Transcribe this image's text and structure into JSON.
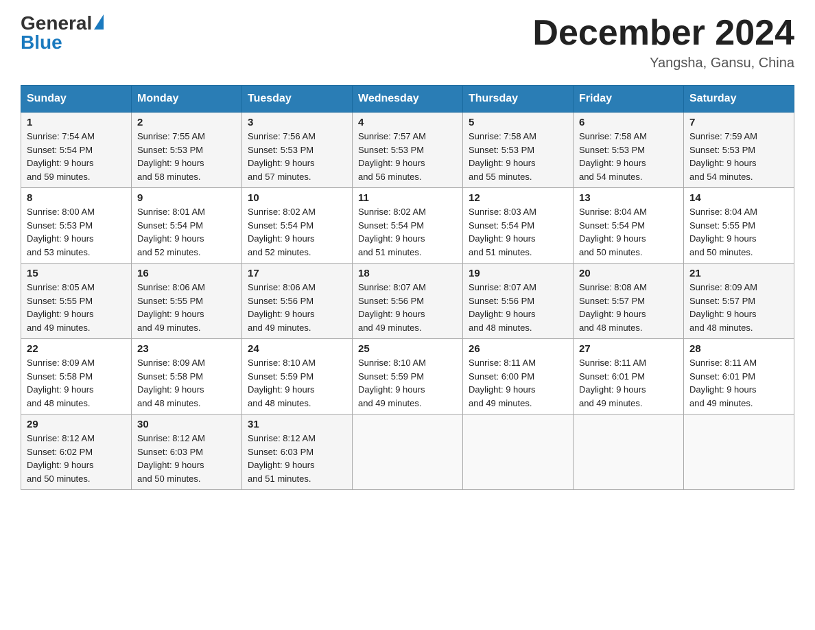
{
  "header": {
    "logo_general": "General",
    "logo_blue": "Blue",
    "month_title": "December 2024",
    "location": "Yangsha, Gansu, China"
  },
  "days_of_week": [
    "Sunday",
    "Monday",
    "Tuesday",
    "Wednesday",
    "Thursday",
    "Friday",
    "Saturday"
  ],
  "weeks": [
    [
      {
        "day": "1",
        "sunrise": "7:54 AM",
        "sunset": "5:54 PM",
        "daylight": "9 hours and 59 minutes."
      },
      {
        "day": "2",
        "sunrise": "7:55 AM",
        "sunset": "5:53 PM",
        "daylight": "9 hours and 58 minutes."
      },
      {
        "day": "3",
        "sunrise": "7:56 AM",
        "sunset": "5:53 PM",
        "daylight": "9 hours and 57 minutes."
      },
      {
        "day": "4",
        "sunrise": "7:57 AM",
        "sunset": "5:53 PM",
        "daylight": "9 hours and 56 minutes."
      },
      {
        "day": "5",
        "sunrise": "7:58 AM",
        "sunset": "5:53 PM",
        "daylight": "9 hours and 55 minutes."
      },
      {
        "day": "6",
        "sunrise": "7:58 AM",
        "sunset": "5:53 PM",
        "daylight": "9 hours and 54 minutes."
      },
      {
        "day": "7",
        "sunrise": "7:59 AM",
        "sunset": "5:53 PM",
        "daylight": "9 hours and 54 minutes."
      }
    ],
    [
      {
        "day": "8",
        "sunrise": "8:00 AM",
        "sunset": "5:53 PM",
        "daylight": "9 hours and 53 minutes."
      },
      {
        "day": "9",
        "sunrise": "8:01 AM",
        "sunset": "5:54 PM",
        "daylight": "9 hours and 52 minutes."
      },
      {
        "day": "10",
        "sunrise": "8:02 AM",
        "sunset": "5:54 PM",
        "daylight": "9 hours and 52 minutes."
      },
      {
        "day": "11",
        "sunrise": "8:02 AM",
        "sunset": "5:54 PM",
        "daylight": "9 hours and 51 minutes."
      },
      {
        "day": "12",
        "sunrise": "8:03 AM",
        "sunset": "5:54 PM",
        "daylight": "9 hours and 51 minutes."
      },
      {
        "day": "13",
        "sunrise": "8:04 AM",
        "sunset": "5:54 PM",
        "daylight": "9 hours and 50 minutes."
      },
      {
        "day": "14",
        "sunrise": "8:04 AM",
        "sunset": "5:55 PM",
        "daylight": "9 hours and 50 minutes."
      }
    ],
    [
      {
        "day": "15",
        "sunrise": "8:05 AM",
        "sunset": "5:55 PM",
        "daylight": "9 hours and 49 minutes."
      },
      {
        "day": "16",
        "sunrise": "8:06 AM",
        "sunset": "5:55 PM",
        "daylight": "9 hours and 49 minutes."
      },
      {
        "day": "17",
        "sunrise": "8:06 AM",
        "sunset": "5:56 PM",
        "daylight": "9 hours and 49 minutes."
      },
      {
        "day": "18",
        "sunrise": "8:07 AM",
        "sunset": "5:56 PM",
        "daylight": "9 hours and 49 minutes."
      },
      {
        "day": "19",
        "sunrise": "8:07 AM",
        "sunset": "5:56 PM",
        "daylight": "9 hours and 48 minutes."
      },
      {
        "day": "20",
        "sunrise": "8:08 AM",
        "sunset": "5:57 PM",
        "daylight": "9 hours and 48 minutes."
      },
      {
        "day": "21",
        "sunrise": "8:09 AM",
        "sunset": "5:57 PM",
        "daylight": "9 hours and 48 minutes."
      }
    ],
    [
      {
        "day": "22",
        "sunrise": "8:09 AM",
        "sunset": "5:58 PM",
        "daylight": "9 hours and 48 minutes."
      },
      {
        "day": "23",
        "sunrise": "8:09 AM",
        "sunset": "5:58 PM",
        "daylight": "9 hours and 48 minutes."
      },
      {
        "day": "24",
        "sunrise": "8:10 AM",
        "sunset": "5:59 PM",
        "daylight": "9 hours and 48 minutes."
      },
      {
        "day": "25",
        "sunrise": "8:10 AM",
        "sunset": "5:59 PM",
        "daylight": "9 hours and 49 minutes."
      },
      {
        "day": "26",
        "sunrise": "8:11 AM",
        "sunset": "6:00 PM",
        "daylight": "9 hours and 49 minutes."
      },
      {
        "day": "27",
        "sunrise": "8:11 AM",
        "sunset": "6:01 PM",
        "daylight": "9 hours and 49 minutes."
      },
      {
        "day": "28",
        "sunrise": "8:11 AM",
        "sunset": "6:01 PM",
        "daylight": "9 hours and 49 minutes."
      }
    ],
    [
      {
        "day": "29",
        "sunrise": "8:12 AM",
        "sunset": "6:02 PM",
        "daylight": "9 hours and 50 minutes."
      },
      {
        "day": "30",
        "sunrise": "8:12 AM",
        "sunset": "6:03 PM",
        "daylight": "9 hours and 50 minutes."
      },
      {
        "day": "31",
        "sunrise": "8:12 AM",
        "sunset": "6:03 PM",
        "daylight": "9 hours and 51 minutes."
      },
      null,
      null,
      null,
      null
    ]
  ],
  "labels": {
    "sunrise": "Sunrise:",
    "sunset": "Sunset:",
    "daylight": "Daylight:"
  }
}
